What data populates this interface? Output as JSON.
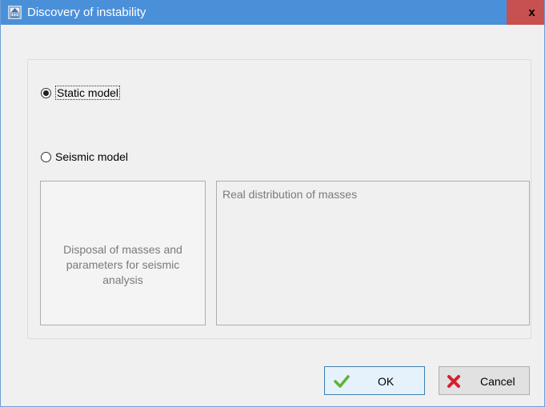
{
  "window": {
    "title": "Discovery of instability",
    "close_label": "x"
  },
  "model_options": {
    "static": {
      "label": "Static model",
      "checked": true
    },
    "seismic": {
      "label": "Seismic model",
      "checked": false
    }
  },
  "seismic_params": {
    "disposal_text": "Disposal of masses and parameters for seismic analysis",
    "distribution_text": "Real distribution of masses"
  },
  "buttons": {
    "ok_label": "OK",
    "cancel_label": "Cancel"
  },
  "icons": {
    "app": "app-grid-icon",
    "ok": "green-check-icon",
    "cancel": "red-x-icon"
  },
  "colors": {
    "titlebar": "#4a90d9",
    "close": "#c75050",
    "ok_check": "#5cb531",
    "cancel_x": "#d3202f"
  }
}
